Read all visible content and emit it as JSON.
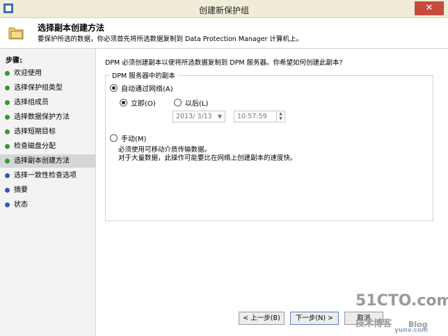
{
  "window": {
    "title": "创建新保护组",
    "close_glyph": "✕"
  },
  "header": {
    "title": "选择副本创建方法",
    "subtitle": "要保护所选的数据，你必须首先将所选数据复制到 Data Protection Manager 计算机上。"
  },
  "steps": {
    "heading": "步骤:",
    "items": [
      {
        "label": "欢迎使用"
      },
      {
        "label": "选择保护组类型"
      },
      {
        "label": "选择组成员"
      },
      {
        "label": "选择数据保护方法"
      },
      {
        "label": "选择短期目标"
      },
      {
        "label": "检查磁盘分配"
      },
      {
        "label": "选择副本创建方法"
      },
      {
        "label": "选择一致性检查选项"
      },
      {
        "label": "摘要"
      },
      {
        "label": "状态"
      }
    ]
  },
  "main": {
    "question": "DPM 必须创建副本以便将所选数据复制到 DPM 服务器。你希望如何创建此副本?",
    "group_title": "DPM 服务器中的副本",
    "auto_label": "自动通过网络(A)",
    "now_label": "立即(O)",
    "later_label": "以后(L)",
    "date_value": "2013/ 3/13",
    "time_value": "10:57:59",
    "manual_label": "手动(M)",
    "manual_note_1": "必须使用可移动介质传输数据。",
    "manual_note_2": "对于大量数据，此操作可能要比在网络上创建副本的速度快。"
  },
  "footer": {
    "back_label": "< 上一步(B)",
    "next_label": "下一步(N) >",
    "cancel_label": "取消"
  },
  "watermark": {
    "line1": "51CTO.com",
    "line2": "技术博客",
    "line3": "Blog",
    "site": "yunv.com"
  },
  "colors": {
    "accent_green": "#2f9a2f",
    "accent_blue": "#3a55b8",
    "titlebar": "#f0ecd8",
    "close": "#c74a3e"
  }
}
